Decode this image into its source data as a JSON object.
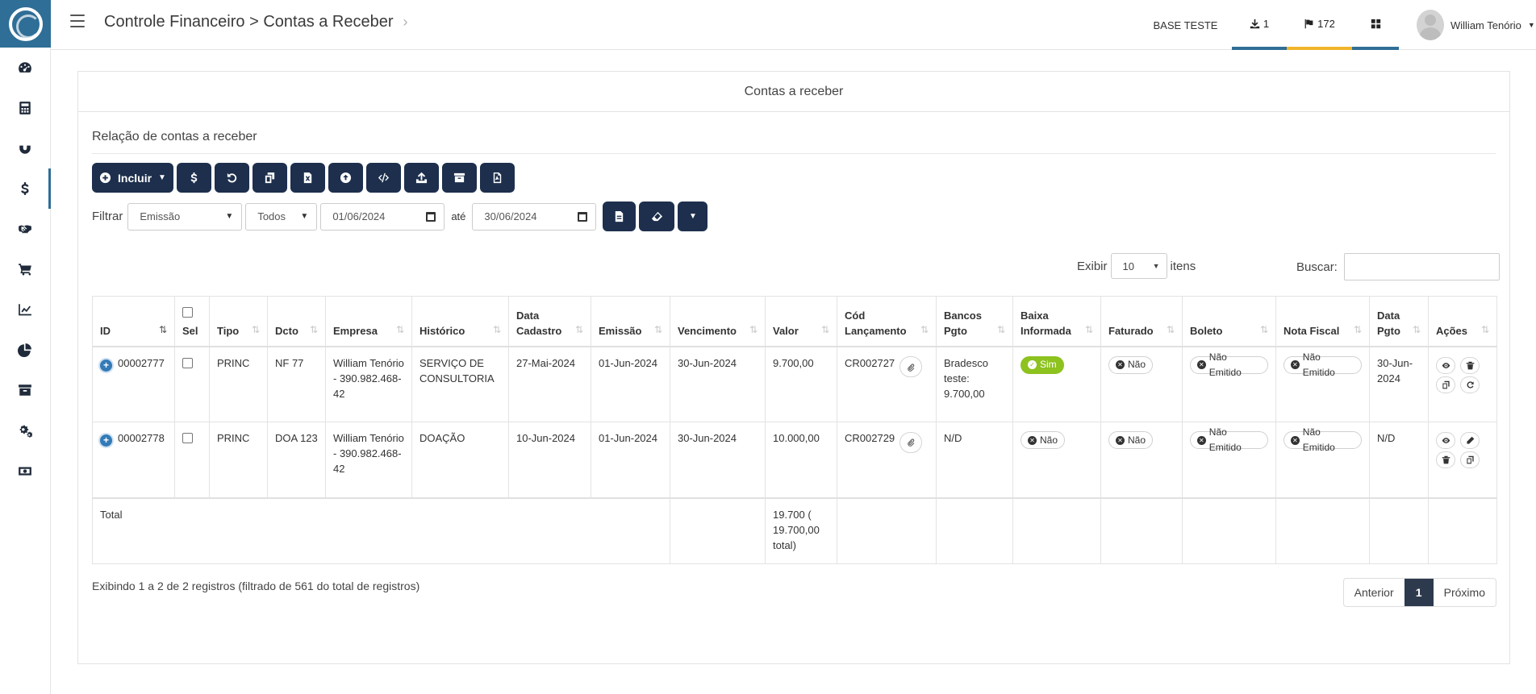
{
  "sidebar": {
    "items": [
      {
        "icon": "dashboard-icon"
      },
      {
        "icon": "calculator-icon"
      },
      {
        "icon": "magnet-icon"
      },
      {
        "icon": "dollar-icon",
        "active": true
      },
      {
        "icon": "handshake-icon"
      },
      {
        "icon": "cart-icon"
      },
      {
        "icon": "line-chart-icon"
      },
      {
        "icon": "pie-chart-icon"
      },
      {
        "icon": "archive-icon"
      },
      {
        "icon": "gears-icon"
      },
      {
        "icon": "money-icon"
      }
    ]
  },
  "header": {
    "breadcrumb": "Controle Financeiro > Contas a Receber",
    "base": "BASE TESTE",
    "download_count": "1",
    "flag_count": "172",
    "user_name": "William Tenório",
    "tab_colors": {
      "download": "#2f6e96",
      "flag": "#f0b429",
      "grid": "#2f6e96"
    }
  },
  "card": {
    "title": "Contas a receber",
    "subtitle": "Relação de contas a receber"
  },
  "toolbar": {
    "incluir_label": "Incluir"
  },
  "filter": {
    "label": "Filtrar",
    "field": "Emissão",
    "status": "Todos",
    "date_from": "01/06/2024",
    "ate": "até",
    "date_to": "30/06/2024"
  },
  "list_controls": {
    "exibir": "Exibir",
    "page_size": "10",
    "itens": "itens",
    "buscar": "Buscar:"
  },
  "table": {
    "headers": {
      "id": "ID",
      "sel": "Sel",
      "tipo": "Tipo",
      "dcto": "Dcto",
      "empresa": "Empresa",
      "historico": "Histórico",
      "data_cadastro_1": "Data",
      "data_cadastro_2": "Cadastro",
      "emissao": "Emissão",
      "vencimento": "Vencimento",
      "valor": "Valor",
      "cod_1": "Cód",
      "cod_2": "Lançamento",
      "bancos_1": "Bancos",
      "bancos_2": "Pgto",
      "baixa_1": "Baixa",
      "baixa_2": "Informada",
      "faturado": "Faturado",
      "boleto": "Boleto",
      "nota_fiscal": "Nota Fiscal",
      "data_pgto_1": "Data",
      "data_pgto_2": "Pgto",
      "acoes": "Ações"
    },
    "rows": [
      {
        "id": "00002777",
        "tipo": "PRINC",
        "dcto": "NF 77",
        "empresa": "William Tenório - 390.982.468-42",
        "historico": "SERVIÇO DE CONSULTORIA",
        "data_cadastro": "27-Mai-2024",
        "emissao": "01-Jun-2024",
        "vencimento": "30-Jun-2024",
        "valor": "9.700,00",
        "cod": "CR002727",
        "bancos": "Bradesco teste: 9.700,00",
        "baixa": "Sim",
        "faturado": "Não",
        "boleto": "Não Emitido",
        "nota_fiscal": "Não Emitido",
        "data_pgto": "30-Jun-2024"
      },
      {
        "id": "00002778",
        "tipo": "PRINC",
        "dcto": "DOA 123",
        "empresa": "William Tenório - 390.982.468-42",
        "historico": "DOAÇÃO",
        "data_cadastro": "10-Jun-2024",
        "emissao": "01-Jun-2024",
        "vencimento": "30-Jun-2024",
        "valor": "10.000,00",
        "cod": "CR002729",
        "bancos": "N/D",
        "baixa": "Não",
        "faturado": "Não",
        "boleto": "Não Emitido",
        "nota_fiscal": "Não Emitido",
        "data_pgto": "N/D"
      }
    ],
    "total_label": "Total",
    "total_value": "19.700 ( 19.700,00 total)"
  },
  "footer": {
    "info": "Exibindo 1 a 2 de 2 registros (filtrado de 561 do total de registros)",
    "prev": "Anterior",
    "current_page": "1",
    "next": "Próximo"
  }
}
